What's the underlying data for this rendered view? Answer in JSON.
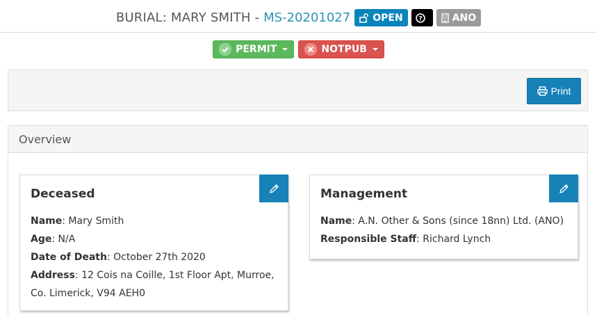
{
  "header": {
    "title": "BURIAL: MARY SMITH",
    "separator": "-",
    "reference": "MS-20201027",
    "badges": {
      "open_label": "OPEN",
      "help_label": "?",
      "ano_label": "ANO"
    }
  },
  "status": {
    "permit_label": "PERMIT",
    "notpub_label": "NOTPUB"
  },
  "toolbar": {
    "print_label": "Print"
  },
  "overview": {
    "title": "Overview",
    "deceased": {
      "title": "Deceased",
      "name_label": "Name",
      "name_value": ": Mary Smith",
      "age_label": "Age",
      "age_value": ": N/A",
      "dod_label": "Date of Death",
      "dod_value": ": October 27th 2020",
      "address_label": "Address",
      "address_value": ": 12 Cois na Coille, 1st Floor Apt, Murroe, Co. Limerick, V94 AEH0"
    },
    "management": {
      "title": "Management",
      "name_label": "Name",
      "name_value": ": A.N. Other & Sons (since 18nn) Ltd. (ANO)",
      "staff_label": "Responsible Staff",
      "staff_value": ": Richard Lynch"
    }
  },
  "colors": {
    "accent": "#1682b8",
    "reference_link": "#2a93b4",
    "permit": "#5cb85c",
    "notpub": "#d9534f",
    "ano_badge": "#9a9a9a"
  },
  "icons": {
    "open": "unlock-icon",
    "help": "question-circle-icon",
    "ano": "building-icon",
    "permit": "check-circle-icon",
    "notpub": "times-circle-icon",
    "print": "printer-icon",
    "edit": "pencil-icon"
  }
}
